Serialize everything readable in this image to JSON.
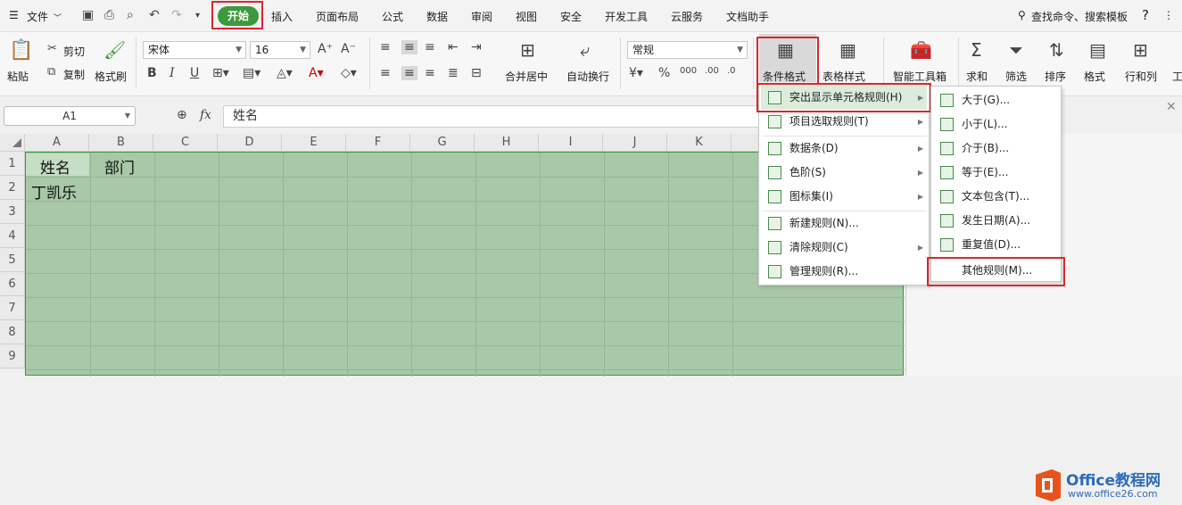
{
  "menubar": {
    "file": "文件",
    "tabs": [
      "开始",
      "插入",
      "页面布局",
      "公式",
      "数据",
      "审阅",
      "视图",
      "安全",
      "开发工具",
      "云服务",
      "文档助手"
    ],
    "search": "查找命令、搜索模板",
    "help": "?"
  },
  "ribbon": {
    "paste": "粘贴",
    "cut": "剪切",
    "copy": "复制",
    "format_painter": "格式刷",
    "font_name": "宋体",
    "font_size": "16",
    "merge": "合并居中",
    "wrap": "自动换行",
    "number_format": "常规",
    "conditional_format": "条件格式",
    "table_style": "表格样式",
    "smart_toolbox": "智能工具箱",
    "sum": "求和",
    "filter": "筛选",
    "sort": "排序",
    "format": "格式",
    "row_col": "行和列",
    "extra": "工"
  },
  "formula_bar": {
    "name_box": "A1",
    "fx": "fx",
    "content": "姓名"
  },
  "grid": {
    "columns": [
      "A",
      "B",
      "C",
      "D",
      "E",
      "F",
      "G",
      "H",
      "I",
      "J",
      "K"
    ],
    "rows": [
      "1",
      "2",
      "3",
      "4",
      "5",
      "6",
      "7",
      "8",
      "9"
    ],
    "cells": {
      "A1": "姓名",
      "B1": "部门",
      "A2": "丁凯乐"
    }
  },
  "cf_menu": [
    "突出显示单元格规则(H)",
    "项目选取规则(T)",
    "数据条(D)",
    "色阶(S)",
    "图标集(I)",
    "新建规则(N)...",
    "清除规则(C)",
    "管理规则(R)..."
  ],
  "sub_menu": [
    "大于(G)...",
    "小于(L)...",
    "介于(B)...",
    "等于(E)...",
    "文本包含(T)...",
    "发生日期(A)...",
    "重复值(D)...",
    "其他规则(M)..."
  ],
  "watermark": {
    "brand": "Office教程网",
    "url": "www.office26.com"
  }
}
